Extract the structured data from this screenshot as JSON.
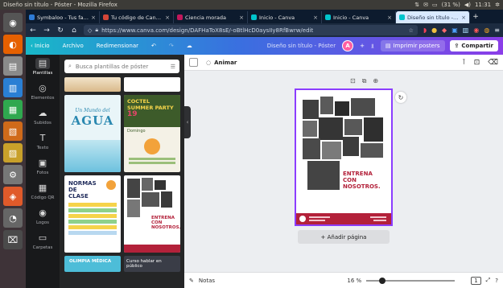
{
  "os": {
    "window_title": "Diseño sin título - Póster - Mozilla Firefox",
    "battery": "(31 %)",
    "clock": "11:31",
    "launcher_apps": [
      "dash-icon",
      "firefox-icon",
      "files-icon",
      "writer-icon",
      "calc-icon",
      "impress-icon",
      "draw-icon",
      "settings-icon",
      "software-icon",
      "system-monitor-icon",
      "trash-icon"
    ]
  },
  "browser": {
    "tabs": [
      {
        "label": "Symbaloo - Tus favorit",
        "color": "#2e7bd6",
        "active": false
      },
      {
        "label": "Tu código de Canva es",
        "color": "#d44638",
        "active": false
      },
      {
        "label": "Ciencia morada",
        "color": "#c2185b",
        "active": false
      },
      {
        "label": "Inicio - Canva",
        "color": "#00c4cc",
        "active": false
      },
      {
        "label": "Inicio - Canva",
        "color": "#00c4cc",
        "active": false
      },
      {
        "label": "Diseño sin título - Pós",
        "color": "#00c4cc",
        "active": true
      }
    ],
    "url": "https://www.canva.com/design/DAFHaToX8sE/-oBtlHcD0aysIIy8RfBwrw/edit"
  },
  "canva": {
    "header": {
      "home": "Inicio",
      "file": "Archivo",
      "resize": "Redimensionar",
      "doc_name": "Diseño sin título - Póster",
      "avatar_letter": "A",
      "print": "Imprimir posters",
      "share": "Compartir"
    },
    "rail": [
      {
        "label": "Plantillas",
        "icon": "▤",
        "active": true
      },
      {
        "label": "Elementos",
        "icon": "◎",
        "active": false
      },
      {
        "label": "Subidos",
        "icon": "☁",
        "active": false
      },
      {
        "label": "Texto",
        "icon": "T",
        "active": false
      },
      {
        "label": "Fotos",
        "icon": "▣",
        "active": false
      },
      {
        "label": "Código QR",
        "icon": "▦",
        "active": false
      },
      {
        "label": "Logos",
        "icon": "◉",
        "active": false
      },
      {
        "label": "Carpetas",
        "icon": "▭",
        "active": false
      }
    ],
    "panel": {
      "search_placeholder": "Busca plantillas de póster",
      "templates": {
        "agua_title": "Un Mundo del",
        "agua_big": "AGUA",
        "coctel_title": "COCTEL SUMMER PARTY",
        "coctel_num": "19",
        "coctel_sub": "Domingo",
        "normas_title": "NORMAS DE CLASE",
        "entrena": "ENTRENA CON NOSOTROS.",
        "olimpia": "OLIMPIA MÉDICA",
        "curso": "Curso hablar en público"
      }
    },
    "toolbar": {
      "animate": "Animar"
    },
    "poster": {
      "headline_1": "ENTRENA",
      "headline_2": "CON",
      "headline_3": "NOSOTROS."
    },
    "add_page": "+ Añadir página",
    "footer": {
      "notes": "Notas",
      "zoom": "16 %",
      "zoom_level": 0.16,
      "page_count": "1"
    }
  }
}
